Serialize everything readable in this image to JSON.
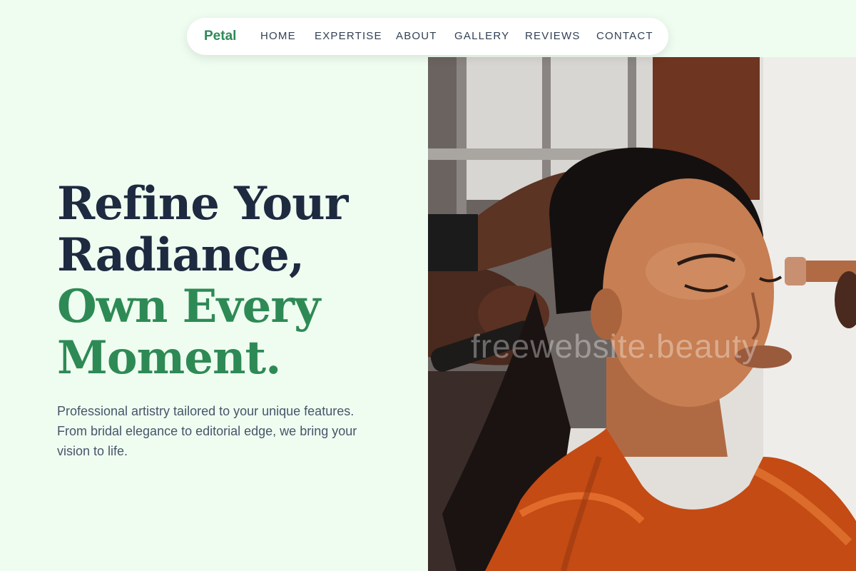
{
  "nav": {
    "brand": "Petal",
    "items": [
      {
        "label": "HOME"
      },
      {
        "label": "EXPERTISE"
      },
      {
        "label": "ABOUT"
      },
      {
        "label": "GALLERY"
      },
      {
        "label": "REVIEWS"
      },
      {
        "label": "CONTACT"
      }
    ]
  },
  "hero": {
    "headline_lines": [
      "Refine Your",
      "Radiance,",
      "Own Every",
      "Moment."
    ],
    "subtext": "Professional artistry tailored to your unique features. From bridal elegance to editorial edge, we bring your vision to life.",
    "image": {
      "watermark": "freewebsite.beauty"
    }
  },
  "colors": {
    "background": "#effdf1",
    "accent_green": "#2e8a55",
    "heading_dark": "#1e2a40",
    "body_text": "#475569"
  }
}
